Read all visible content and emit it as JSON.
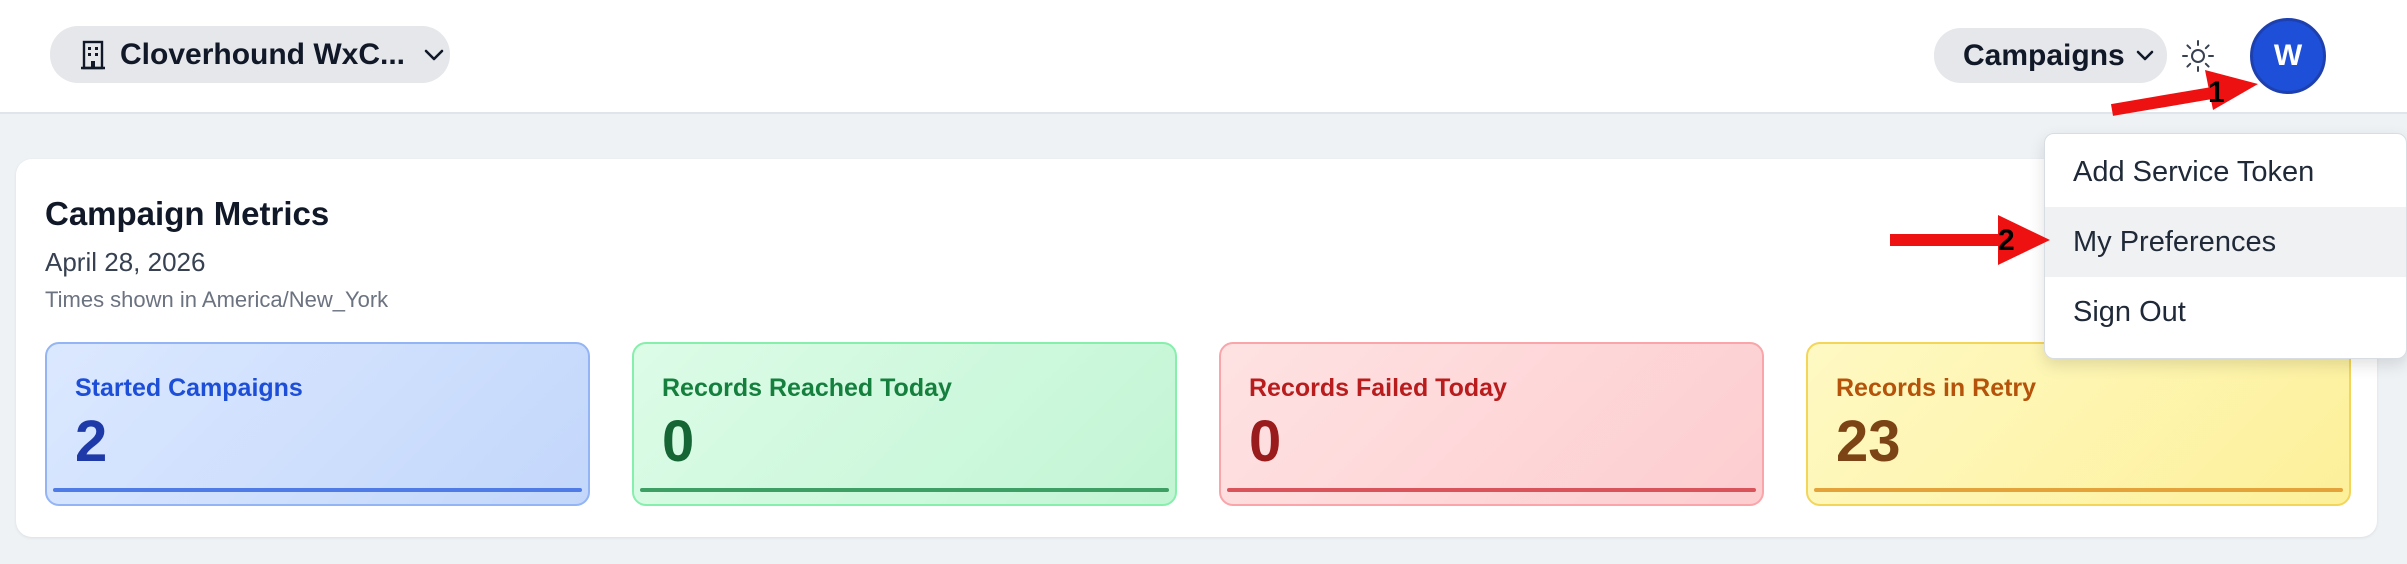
{
  "header": {
    "org_select_label": "Cloverhound WxC...",
    "nav_select_label": "Campaigns",
    "avatar_initial": "W"
  },
  "icons": {
    "org": "building-icon",
    "chevron": "chevron-down-icon",
    "theme": "sun-icon"
  },
  "metrics_card": {
    "title": "Campaign Metrics",
    "date": "April 28, 2026",
    "timezone_note": "Times shown in America/New_York",
    "metrics": [
      {
        "label": "Started Campaigns",
        "value": "2",
        "color": "#1d4ed8"
      },
      {
        "label": "Records Reached Today",
        "value": "0",
        "color": "#15803d"
      },
      {
        "label": "Records Failed Today",
        "value": "0",
        "color": "#b91c1c"
      },
      {
        "label": "Records in Retry",
        "value": "23",
        "color": "#b45309"
      }
    ]
  },
  "user_menu": {
    "items": [
      {
        "label": "Add Service Token"
      },
      {
        "label": "My Preferences",
        "highlighted": true
      },
      {
        "label": "Sign Out"
      }
    ]
  },
  "annotations": {
    "arrow_color": "#ee1111",
    "labels": [
      "1",
      "2"
    ]
  }
}
